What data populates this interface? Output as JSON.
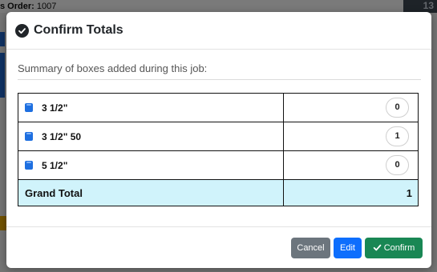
{
  "background": {
    "order_label": "s Order:",
    "order_number": "1007",
    "corner_number": "13"
  },
  "modal": {
    "title": "Confirm Totals",
    "title_icon": "check-circle-icon",
    "summary_text": "Summary of boxes added during this job:",
    "rows": [
      {
        "label": "3 1/2\"",
        "qty": "0",
        "icon": "box-icon"
      },
      {
        "label": "3 1/2\" 50",
        "qty": "1",
        "icon": "box-icon"
      },
      {
        "label": "5 1/2\"",
        "qty": "0",
        "icon": "box-icon"
      }
    ],
    "total": {
      "label": "Grand Total",
      "value": "1"
    },
    "buttons": {
      "cancel": "Cancel",
      "edit": "Edit",
      "confirm": "Confirm"
    }
  },
  "colors": {
    "cancel": "#6c757d",
    "edit": "#0d6efd",
    "confirm": "#198754",
    "total_row": "#d0f3fb",
    "box_icon": "#1e6fe0"
  }
}
